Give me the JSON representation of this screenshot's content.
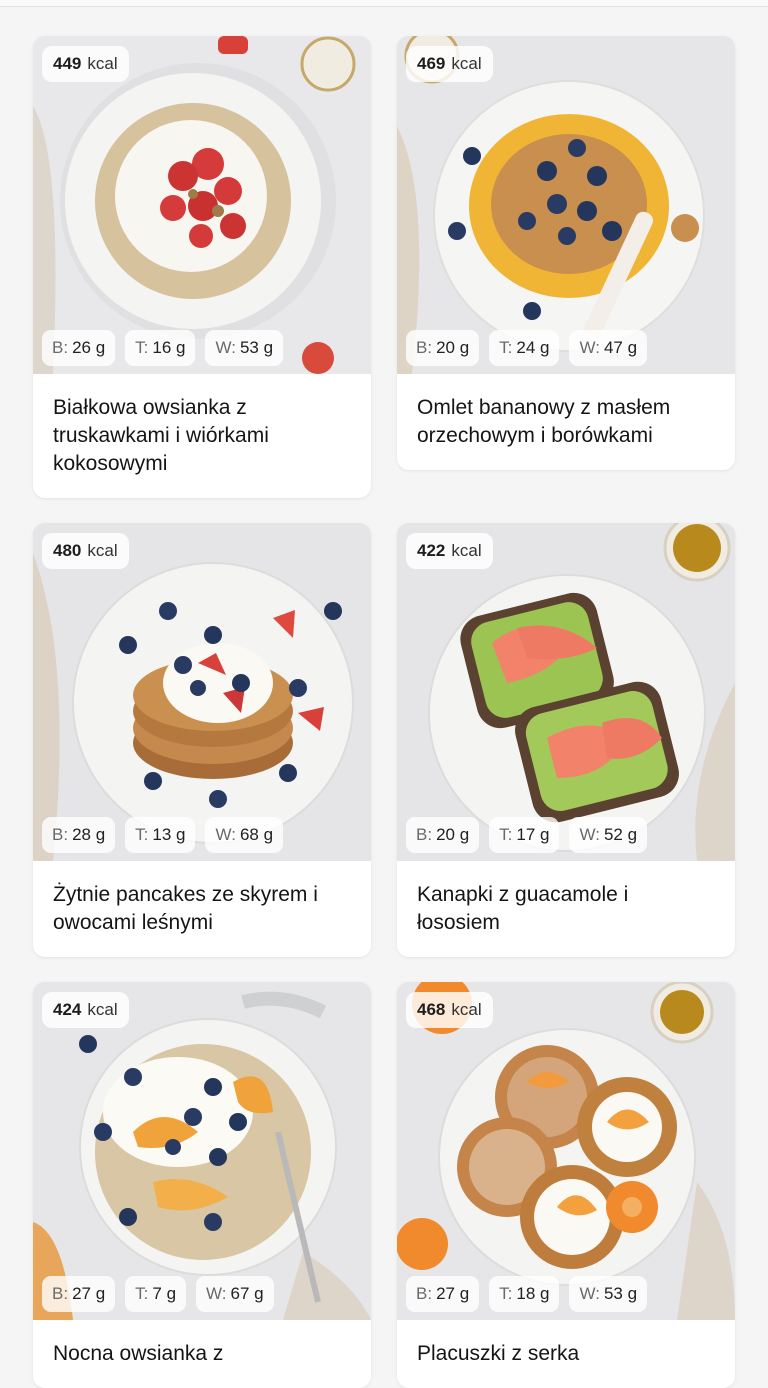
{
  "cards": [
    {
      "kcal": "449",
      "kcal_unit": "kcal",
      "b": "B:",
      "b_val": "26 g",
      "t": "T:",
      "t_val": "16 g",
      "w": "W:",
      "w_val": "53 g",
      "title": "Białkowa owsianka z truskawkami i wiórkami kokosowymi",
      "image": "oatmeal-strawberries"
    },
    {
      "kcal": "469",
      "kcal_unit": "kcal",
      "b": "B:",
      "b_val": "20 g",
      "t": "T:",
      "t_val": "24 g",
      "w": "W:",
      "w_val": "47 g",
      "title": "Omlet bananowy z masłem orzechowym i borówkami",
      "image": "omelette-blueberries"
    },
    {
      "kcal": "480",
      "kcal_unit": "kcal",
      "b": "B:",
      "b_val": "28 g",
      "t": "T:",
      "t_val": "13 g",
      "w": "W:",
      "w_val": "68 g",
      "title": "Żytnie pancakes ze skyrem i owocami leśnymi",
      "image": "pancakes-berries"
    },
    {
      "kcal": "422",
      "kcal_unit": "kcal",
      "b": "B:",
      "b_val": "20 g",
      "t": "T:",
      "t_val": "17 g",
      "w": "W:",
      "w_val": "52 g",
      "title": "Kanapki z guacamole i łososiem",
      "image": "toast-avocado-salmon"
    },
    {
      "kcal": "424",
      "kcal_unit": "kcal",
      "b": "B:",
      "b_val": "27 g",
      "t": "T:",
      "t_val": "7 g",
      "w": "W:",
      "w_val": "67 g",
      "title": "Nocna owsianka z",
      "image": "overnight-oats-peach"
    },
    {
      "kcal": "468",
      "kcal_unit": "kcal",
      "b": "B:",
      "b_val": "27 g",
      "t": "T:",
      "t_val": "18 g",
      "w": "W:",
      "w_val": "53 g",
      "title": "Placuszki z serka",
      "image": "pancakes-apricot"
    }
  ],
  "colors": {
    "background": "#f5f5f5",
    "card": "#ffffff",
    "text": "#151515",
    "badge": "#ffffff"
  }
}
